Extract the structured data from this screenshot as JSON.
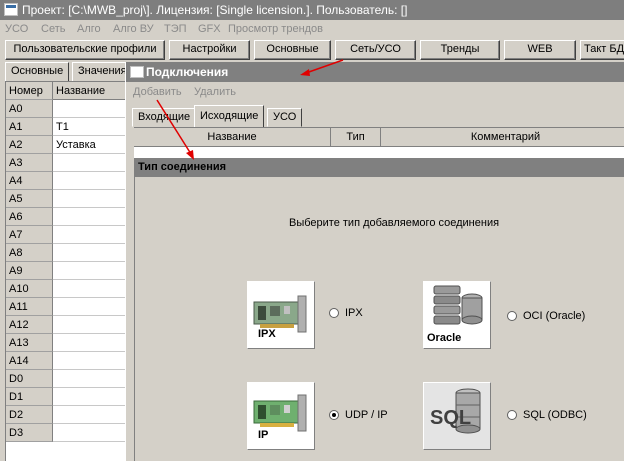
{
  "window": {
    "title": "Проект: [C:\\MWB_proj\\]. Лицензия: [Single licension.]. Пользователь: []",
    "icon": "app-window-icon"
  },
  "menu": [
    "УСО",
    "Сеть",
    "Алго",
    "Алго ВУ",
    "ТЭП",
    "GFX",
    "Просмотр трендов"
  ],
  "toolbar": [
    "Пользовательские профили",
    "Настройки",
    "Основные",
    "Сеть/УСО",
    "Тренды",
    "WEB",
    "Такт БД"
  ],
  "left_panel": {
    "tabs": [
      "Основные",
      "Значения"
    ],
    "columns": [
      "Номер",
      "Название"
    ],
    "rows": [
      {
        "num": "A0",
        "name": ""
      },
      {
        "num": "A1",
        "name": "T1"
      },
      {
        "num": "A2",
        "name": "Уставка"
      },
      {
        "num": "A3",
        "name": ""
      },
      {
        "num": "A4",
        "name": ""
      },
      {
        "num": "A5",
        "name": ""
      },
      {
        "num": "A6",
        "name": ""
      },
      {
        "num": "A7",
        "name": ""
      },
      {
        "num": "A8",
        "name": ""
      },
      {
        "num": "A9",
        "name": ""
      },
      {
        "num": "A10",
        "name": ""
      },
      {
        "num": "A11",
        "name": ""
      },
      {
        "num": "A12",
        "name": ""
      },
      {
        "num": "A13",
        "name": ""
      },
      {
        "num": "A14",
        "name": ""
      },
      {
        "num": "D0",
        "name": ""
      },
      {
        "num": "D1",
        "name": ""
      },
      {
        "num": "D2",
        "name": ""
      },
      {
        "num": "D3",
        "name": ""
      }
    ]
  },
  "connections_window": {
    "title": "Подключения",
    "menu": [
      "Добавить",
      "Удалить"
    ],
    "tabs": [
      "Входящие",
      "Исходящие",
      "УСО"
    ],
    "active_tab": "Исходящие",
    "columns": [
      "Название",
      "Тип",
      "Комментарий"
    ]
  },
  "dialog": {
    "title": "Тип соединения",
    "prompt": "Выберите тип добавляемого соединения",
    "options": [
      {
        "label": "IPX",
        "icon_text": "IPX",
        "icon": "network-card-icon",
        "selected": false
      },
      {
        "label": "OCI (Oracle)",
        "icon_text": "Oracle",
        "icon": "database-server-icon",
        "selected": false
      },
      {
        "label": "UDP / IP",
        "icon_text": "IP",
        "icon": "network-card-icon",
        "selected": true
      },
      {
        "label": "SQL (ODBC)",
        "icon_text": "SQL",
        "icon": "sql-database-icon",
        "selected": false
      }
    ]
  },
  "colors": {
    "annotation_arrow": "#e00000",
    "titlebar_inactive": "#808080",
    "face": "#d4d0c8"
  }
}
